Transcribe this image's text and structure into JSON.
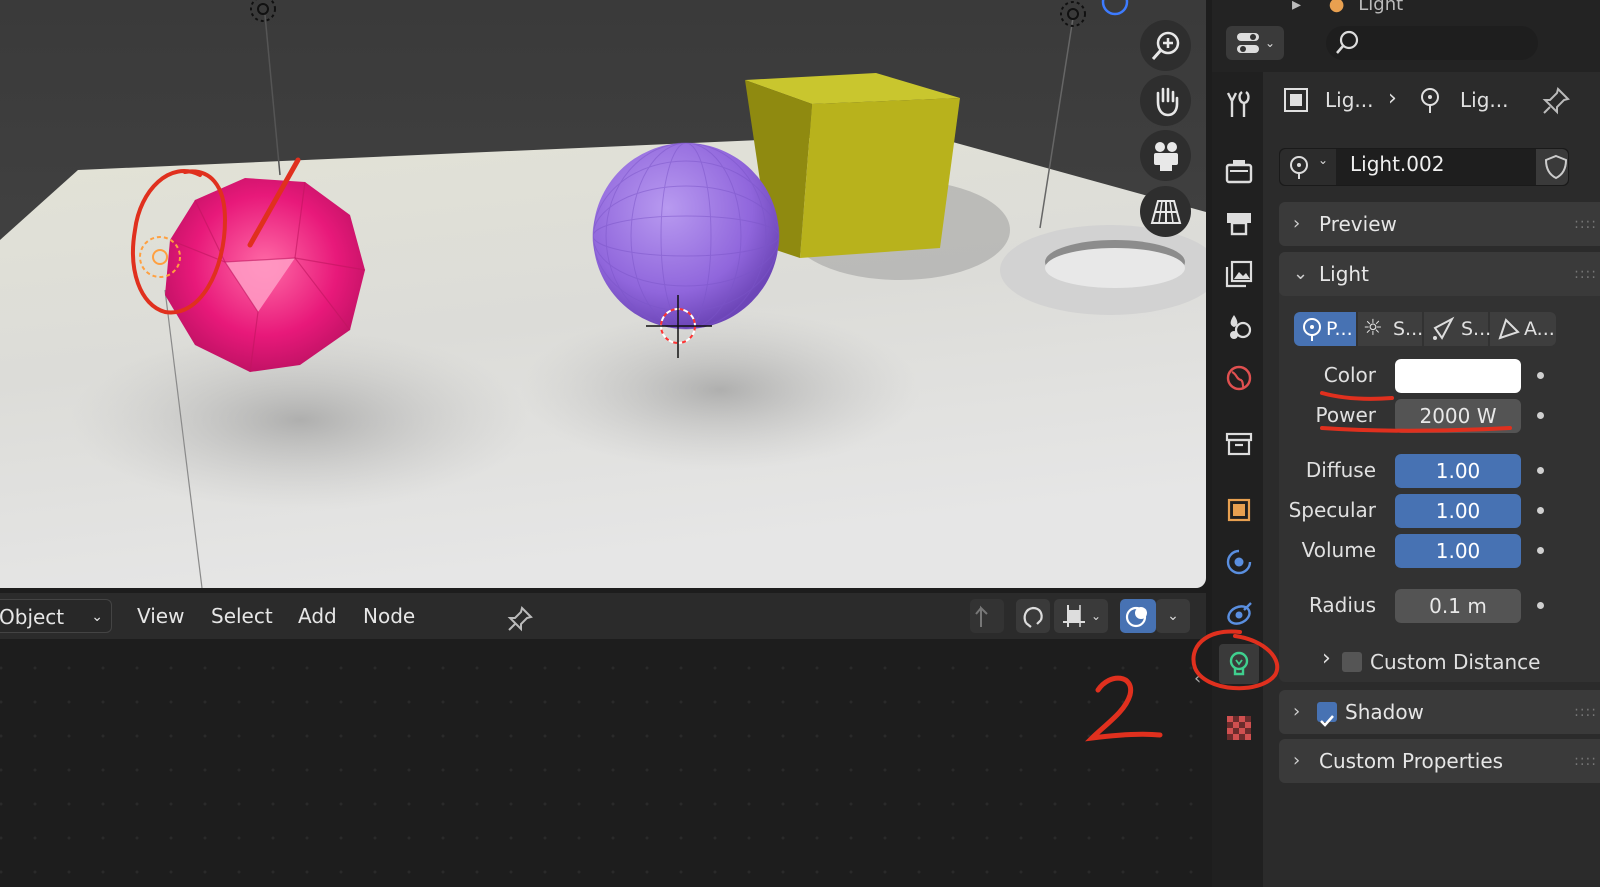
{
  "node_editor": {
    "mode": "Object",
    "menu": [
      "View",
      "Select",
      "Add",
      "Node"
    ]
  },
  "properties": {
    "header_item": "Light",
    "breadcrumb": [
      "Lig...",
      "Lig..."
    ],
    "datablock_name": "Light.002",
    "panels": {
      "preview": "Preview",
      "light": "Light",
      "shadow": "Shadow",
      "custom_properties": "Custom Properties"
    },
    "light_types": [
      "P...",
      "S...",
      "S...",
      "A..."
    ],
    "fields": {
      "color_label": "Color",
      "power_label": "Power",
      "power_value": "2000 W",
      "diffuse_label": "Diffuse",
      "diffuse_value": "1.00",
      "specular_label": "Specular",
      "specular_value": "1.00",
      "volume_label": "Volume",
      "volume_value": "1.00",
      "radius_label": "Radius",
      "radius_value": "0.1 m",
      "custom_distance_label": "Custom Distance"
    },
    "shadow_enabled": true,
    "custom_distance_enabled": false
  },
  "annotations": {
    "step2_label": "2"
  },
  "colors": {
    "accent_blue": "#4772b3",
    "annotation_red": "#e0301e",
    "light_tab_green": "#3fcf8e"
  }
}
